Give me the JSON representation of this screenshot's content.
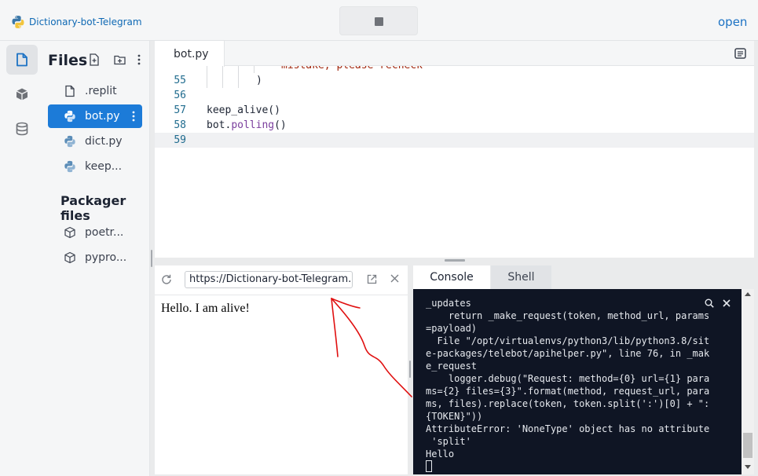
{
  "header": {
    "app_title": "Dictionary-bot-Telegram",
    "open_label": "open"
  },
  "files": {
    "title": "Files",
    "items": [
      {
        "label": ".replit",
        "icon": "file-icon"
      },
      {
        "label": "bot.py",
        "icon": "python-icon",
        "active": true
      },
      {
        "label": "dict.py",
        "icon": "python-icon"
      },
      {
        "label": "keep...",
        "icon": "python-icon"
      }
    ],
    "packager_title": "Packager files",
    "packager_items": [
      {
        "label": "poetr...",
        "icon": "package-icon"
      },
      {
        "label": "pypro...",
        "icon": "package-icon"
      }
    ]
  },
  "editor": {
    "tab_label": "bot.py",
    "lines": [
      {
        "num": "",
        "text": "mistake, please recheck"
      },
      {
        "num": "55",
        "text": ")"
      },
      {
        "num": "56",
        "text": ""
      },
      {
        "num": "57",
        "text": "keep_alive()"
      },
      {
        "num": "58",
        "text_obj": "bot",
        "text_dot": ".",
        "text_fn": "polling",
        "text_end": "()"
      },
      {
        "num": "59",
        "text": ""
      }
    ]
  },
  "webview": {
    "url": "https://Dictionary-bot-Telegram.abl",
    "content": "Hello. I am alive!"
  },
  "console": {
    "tabs": [
      "Console",
      "Shell"
    ],
    "output": "_updates\n    return _make_request(token, method_url, params\n=payload)\n  File \"/opt/virtualenvs/python3/lib/python3.8/sit\ne-packages/telebot/apihelper.py\", line 76, in _mak\ne_request\n    logger.debug(\"Request: method={0} url={1} para\nms={2} files={3}\".format(method, request_url, para\nms, files).replace(token, token.split(':')[0] + \":\n{TOKEN}\"))\nAttributeError: 'NoneType' object has no attribute\n 'split'\nHello"
  },
  "colors": {
    "accent": "#1c7bd8",
    "terminal_bg": "#0f1524",
    "annotation": "#e01010"
  }
}
